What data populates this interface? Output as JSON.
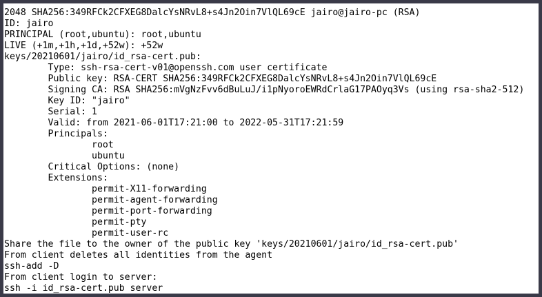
{
  "terminal": {
    "lines": [
      "2048 SHA256:349RFCk2CFXEG8DalcYsNRvL8+s4Jn2Oin7VlQL69cE jairo@jairo-pc (RSA)",
      "ID: jairo",
      "PRINCIPAL (root,ubuntu): root,ubuntu",
      "LIVE (+1m,+1h,+1d,+52w): +52w",
      "keys/20210601/jairo/id_rsa-cert.pub:",
      "        Type: ssh-rsa-cert-v01@openssh.com user certificate",
      "        Public key: RSA-CERT SHA256:349RFCk2CFXEG8DalcYsNRvL8+s4Jn2Oin7VlQL69cE",
      "        Signing CA: RSA SHA256:mVgNzFvv6dBuLuJ/i1pNyoroEWRdCrlaG17PAOyq3Vs (using rsa-sha2-512)",
      "        Key ID: \"jairo\"",
      "        Serial: 1",
      "        Valid: from 2021-06-01T17:21:00 to 2022-05-31T17:21:59",
      "        Principals:",
      "                root",
      "                ubuntu",
      "        Critical Options: (none)",
      "        Extensions:",
      "                permit-X11-forwarding",
      "                permit-agent-forwarding",
      "                permit-port-forwarding",
      "                permit-pty",
      "                permit-user-rc",
      "Share the file to the owner of the public key 'keys/20210601/jairo/id_rsa-cert.pub'",
      "From client deletes all identities from the agent",
      "ssh-add -D",
      "From client login to server:",
      "ssh -i id_rsa-cert.pub server"
    ]
  },
  "colors": {
    "background": "#ffffff",
    "text": "#000000",
    "frame": "#3a3a48"
  }
}
